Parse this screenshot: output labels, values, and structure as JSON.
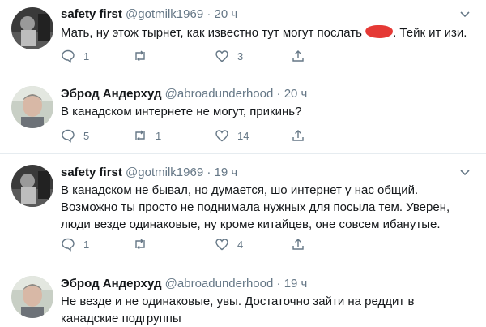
{
  "colors": {
    "icon": "#657786",
    "redaction": "#e53935",
    "divider": "#e6ecf0"
  },
  "tweets": [
    {
      "name": "safety first",
      "handle": "@gotmilk1969",
      "dot": "·",
      "time": "20 ч",
      "text_before": "Мать, ну этож тырнет, как известно тут могут послать",
      "text_after": ". Тейк ит изи.",
      "replies": "1",
      "retweets": "",
      "likes": "3",
      "avatar": "dark-photo"
    },
    {
      "name": "Эброд Андерхуд",
      "handle": "@abroadunderhood",
      "dot": "·",
      "time": "20 ч",
      "text": "В канадском интернете не могут, прикинь?",
      "replies": "5",
      "retweets": "1",
      "likes": "14",
      "avatar": "light-photo"
    },
    {
      "name": "safety first",
      "handle": "@gotmilk1969",
      "dot": "·",
      "time": "19 ч",
      "text": "В канадском не бывал, но думается, шо интернет у нас общий. Возможно ты просто не поднимала нужных для посыла тем. Уверен, люди везде одинаковые, ну кроме китайцев, оне совсем ибанутые.",
      "replies": "1",
      "retweets": "",
      "likes": "4",
      "avatar": "dark-photo"
    },
    {
      "name": "Эброд Андерхуд",
      "handle": "@abroadunderhood",
      "dot": "·",
      "time": "19 ч",
      "text": "Не везде и не одинаковые, увы. Достаточно зайти на реддит в канадские подгруппы",
      "avatar": "light-photo"
    }
  ]
}
